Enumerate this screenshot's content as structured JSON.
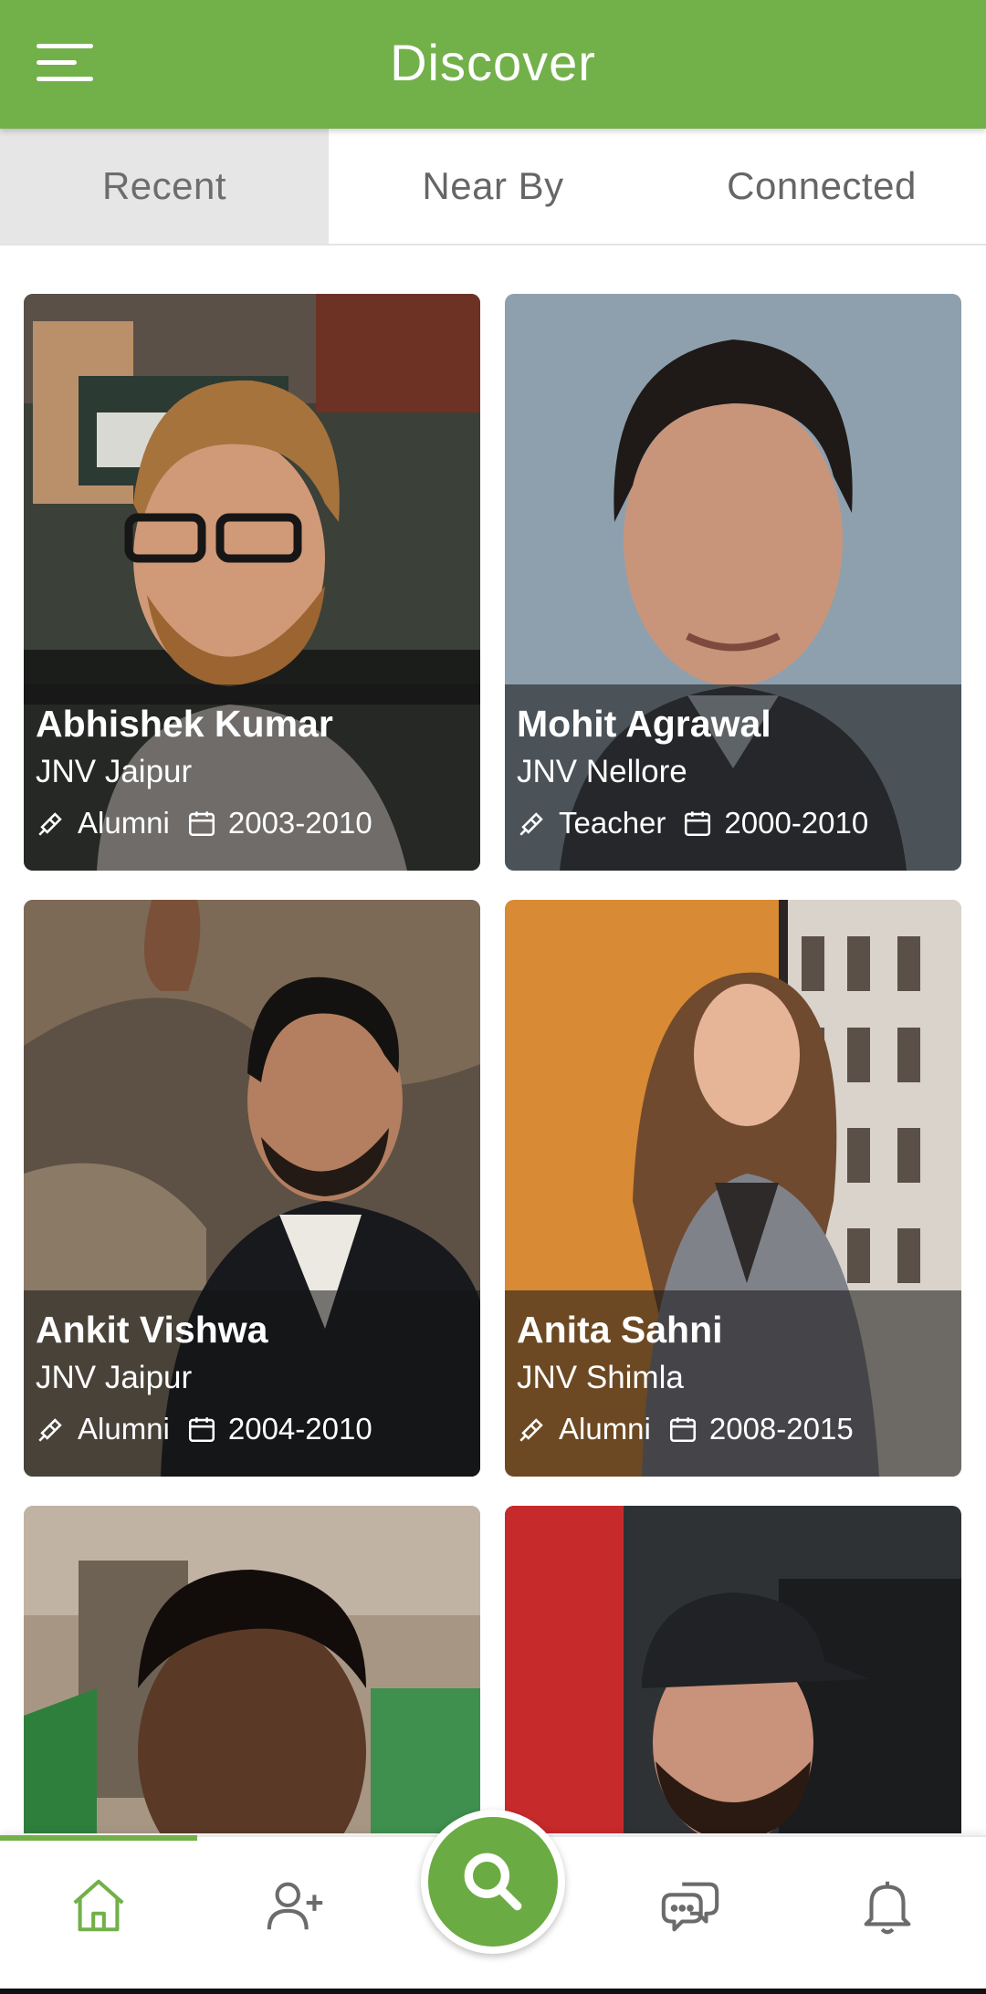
{
  "header": {
    "title": "Discover",
    "menu_icon": "hamburger-menu-icon",
    "color": "#72b04a"
  },
  "tabs": [
    {
      "label": "Recent",
      "active": true
    },
    {
      "label": "Near By",
      "active": false
    },
    {
      "label": "Connected",
      "active": false
    }
  ],
  "profiles": [
    {
      "name": "Abhishek Kumar",
      "school": "JNV Jaipur",
      "role": "Alumni",
      "years": "2003-2010"
    },
    {
      "name": "Mohit Agrawal",
      "school": "JNV Nellore",
      "role": "Teacher",
      "years": "2000-2010"
    },
    {
      "name": "Ankit Vishwa",
      "school": "JNV Jaipur",
      "role": "Alumni",
      "years": "2004-2010"
    },
    {
      "name": "Anita Sahni",
      "school": "JNV Shimla",
      "role": "Alumni",
      "years": "2008-2015"
    }
  ],
  "bottom_nav": {
    "items": [
      {
        "icon": "home-icon",
        "active": true
      },
      {
        "icon": "add-user-icon",
        "active": false
      },
      {
        "icon": "search-icon",
        "active": false
      },
      {
        "icon": "chat-icon",
        "active": false
      },
      {
        "icon": "bell-icon",
        "active": false
      }
    ],
    "active_color": "#72b04a"
  }
}
